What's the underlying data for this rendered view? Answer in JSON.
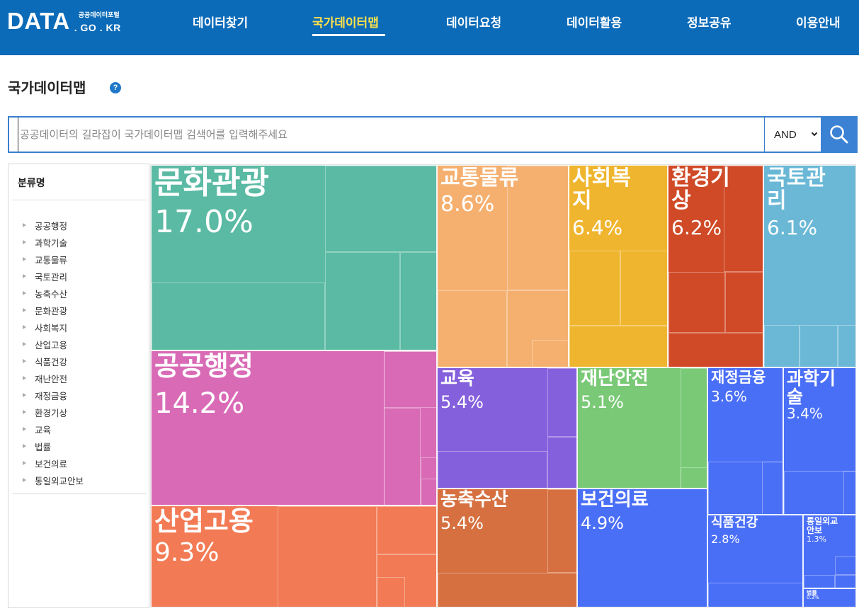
{
  "header": {
    "logo_main": "DATA",
    "logo_small": "공공데이터포털",
    "logo_sub": ". GO . KR",
    "nav": [
      "데이터찾기",
      "국가데이터맵",
      "데이터요청",
      "데이터활용",
      "정보공유",
      "이용안내"
    ],
    "active_nav": "국가데이터맵",
    "bg_color": "#0b6bb8",
    "active_color": "#ffe14a"
  },
  "page": {
    "title": "국가데이터맵",
    "help_icon": "question-circle-icon",
    "help_glyph": "?"
  },
  "search": {
    "placeholder": "공공데이터의 길라잡이 국가데이터맵 검색어를 입력해주세요",
    "value": "",
    "operator": "AND",
    "icon": "search-icon"
  },
  "sidebar": {
    "title": "분류명",
    "categories": [
      "공공행정",
      "과학기술",
      "교통물류",
      "국토관리",
      "농축수산",
      "문화관광",
      "사회복지",
      "산업고용",
      "식품건강",
      "재난안전",
      "재정금융",
      "환경기상",
      "교육",
      "법률",
      "보건의료",
      "통일외교안보"
    ]
  },
  "treemap": {
    "cells": [
      {
        "label": "문화관광",
        "label_lines": [
          "문화관광"
        ],
        "percent": "17.0%",
        "color": "#5abaa4"
      },
      {
        "label": "공공행정",
        "label_lines": [
          "공공행정"
        ],
        "percent": "14.2%",
        "color": "#d96bb6"
      },
      {
        "label": "산업고용",
        "label_lines": [
          "산업고용"
        ],
        "percent": "9.3%",
        "color": "#f27a54"
      },
      {
        "label": "교통물류",
        "label_lines": [
          "교통물류"
        ],
        "percent": "8.6%",
        "color": "#f5b070"
      },
      {
        "label": "사회복지",
        "label_lines": [
          "사회복",
          "지"
        ],
        "percent": "6.4%",
        "color": "#f0b52e"
      },
      {
        "label": "환경기상",
        "label_lines": [
          "환경기",
          "상"
        ],
        "percent": "6.2%",
        "color": "#d04a27"
      },
      {
        "label": "국토관리",
        "label_lines": [
          "국토관",
          "리"
        ],
        "percent": "6.1%",
        "color": "#6ab8d6"
      },
      {
        "label": "교육",
        "label_lines": [
          "교육"
        ],
        "percent": "5.4%",
        "color": "#8560dd"
      },
      {
        "label": "재난안전",
        "label_lines": [
          "재난안전"
        ],
        "percent": "5.1%",
        "color": "#79c976"
      },
      {
        "label": "재정금융",
        "label_lines": [
          "재정금융"
        ],
        "percent": "3.6%",
        "color": "#4a6ff7"
      },
      {
        "label": "과학기술",
        "label_lines": [
          "과학기",
          "술"
        ],
        "percent": "3.4%",
        "color": "#4a6ff7"
      },
      {
        "label": "농축수산",
        "label_lines": [
          "농축수산"
        ],
        "percent": "5.4%",
        "color": "#d67040"
      },
      {
        "label": "보건의료",
        "label_lines": [
          "보건의료"
        ],
        "percent": "4.9%",
        "color": "#4a6ff7"
      },
      {
        "label": "식품건강",
        "label_lines": [
          "식품건강"
        ],
        "percent": "2.8%",
        "color": "#4a6ff7"
      },
      {
        "label": "통일외교안보",
        "label_lines": [
          "통일외교",
          "안보"
        ],
        "percent": "1.3%",
        "color": "#4a6ff7"
      },
      {
        "label": "법률",
        "label_lines": [
          "법률"
        ],
        "percent": "0.3%",
        "color": "#4a6ff7"
      }
    ]
  }
}
